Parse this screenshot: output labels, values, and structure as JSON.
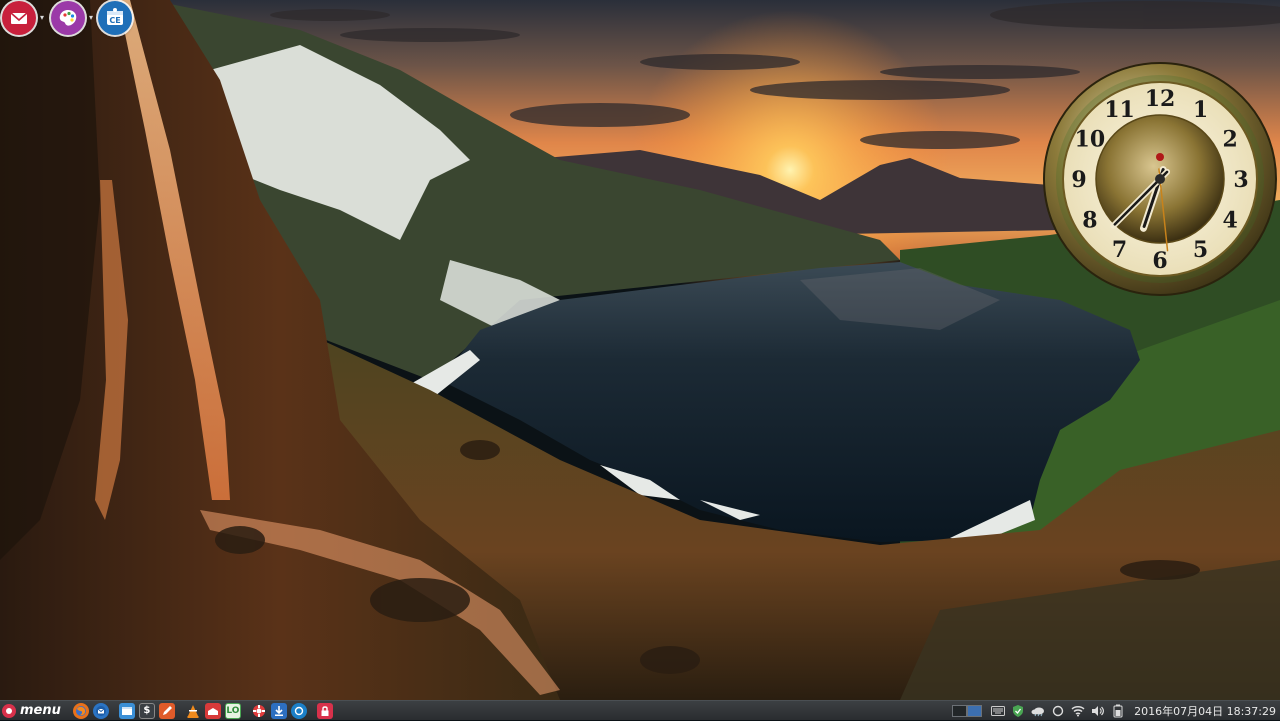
{
  "desktop": {
    "launchers": [
      {
        "name": "mail",
        "color": "#c8203c"
      },
      {
        "name": "theme-palette",
        "color": "#9b3aa8"
      },
      {
        "name": "ce-info",
        "color": "#1f6fb8"
      }
    ]
  },
  "clock_widget": {
    "hour_numerals": [
      "12",
      "1",
      "2",
      "3",
      "4",
      "5",
      "6",
      "7",
      "8",
      "9",
      "10",
      "11"
    ],
    "time_shown": "18:37:29"
  },
  "taskbar": {
    "menu_label": "menu",
    "apps": [
      {
        "name": "firefox-icon",
        "color": "#e8711a"
      },
      {
        "name": "thunderbird-icon",
        "color": "#2b74c4"
      },
      {
        "name": "file-manager-icon",
        "color": "#3b8fd6"
      },
      {
        "name": "terminal-icon",
        "color": "#3a3f44"
      },
      {
        "name": "text-editor-icon",
        "color": "#e05b2a"
      },
      {
        "name": "vlc-icon",
        "color": "#f08a1c"
      },
      {
        "name": "mail-client-icon",
        "color": "#d83a3a"
      },
      {
        "name": "libreoffice-icon",
        "color": "#4aa653"
      },
      {
        "name": "lifebuoy-icon",
        "color": "#e03c3c"
      },
      {
        "name": "downloader-icon",
        "color": "#2d6fc0"
      },
      {
        "name": "power-icon",
        "color": "#1b80c8"
      },
      {
        "name": "lock-icon",
        "color": "#d8314b"
      }
    ],
    "terminal_glyph": "$",
    "office_glyph": "LO",
    "tray_icons": [
      "keyboard-icon",
      "shield-icon",
      "weather-icon",
      "circle-icon",
      "wifi-icon",
      "volume-icon",
      "battery-icon"
    ],
    "datetime": "2016年07月04日 18:37:29"
  }
}
